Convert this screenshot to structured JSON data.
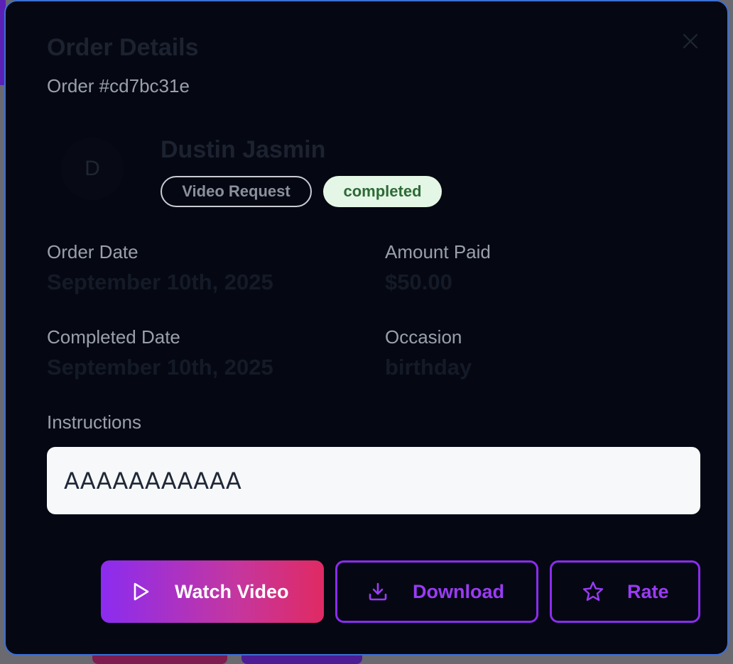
{
  "modal": {
    "title": "Order Details",
    "order_id": "Order #cd7bc31e",
    "close_icon": "close-icon"
  },
  "customer": {
    "avatar_initial": "D",
    "name": "Dustin Jasmin",
    "request_type": "Video Request",
    "status": "completed"
  },
  "details": {
    "order_date_label": "Order Date",
    "order_date_value": "September 10th, 2025",
    "amount_label": "Amount Paid",
    "amount_value": "$50.00",
    "completed_label": "Completed Date",
    "completed_value": "September 10th, 2025",
    "occasion_label": "Occasion",
    "occasion_value": "birthday"
  },
  "instructions": {
    "label": "Instructions",
    "text": "AAAAAAAAAAA"
  },
  "actions": {
    "watch_label": "Watch Video",
    "watch_icon": "play-icon",
    "download_label": "Download",
    "download_icon": "download-icon",
    "rate_label": "Rate",
    "rate_icon": "star-icon"
  },
  "colors": {
    "accent": "#8b2cf0",
    "accent_gradient_end": "#e02a63",
    "status_bg": "#e4f7e6",
    "status_text": "#2f6a36",
    "modal_bg": "#050812"
  }
}
